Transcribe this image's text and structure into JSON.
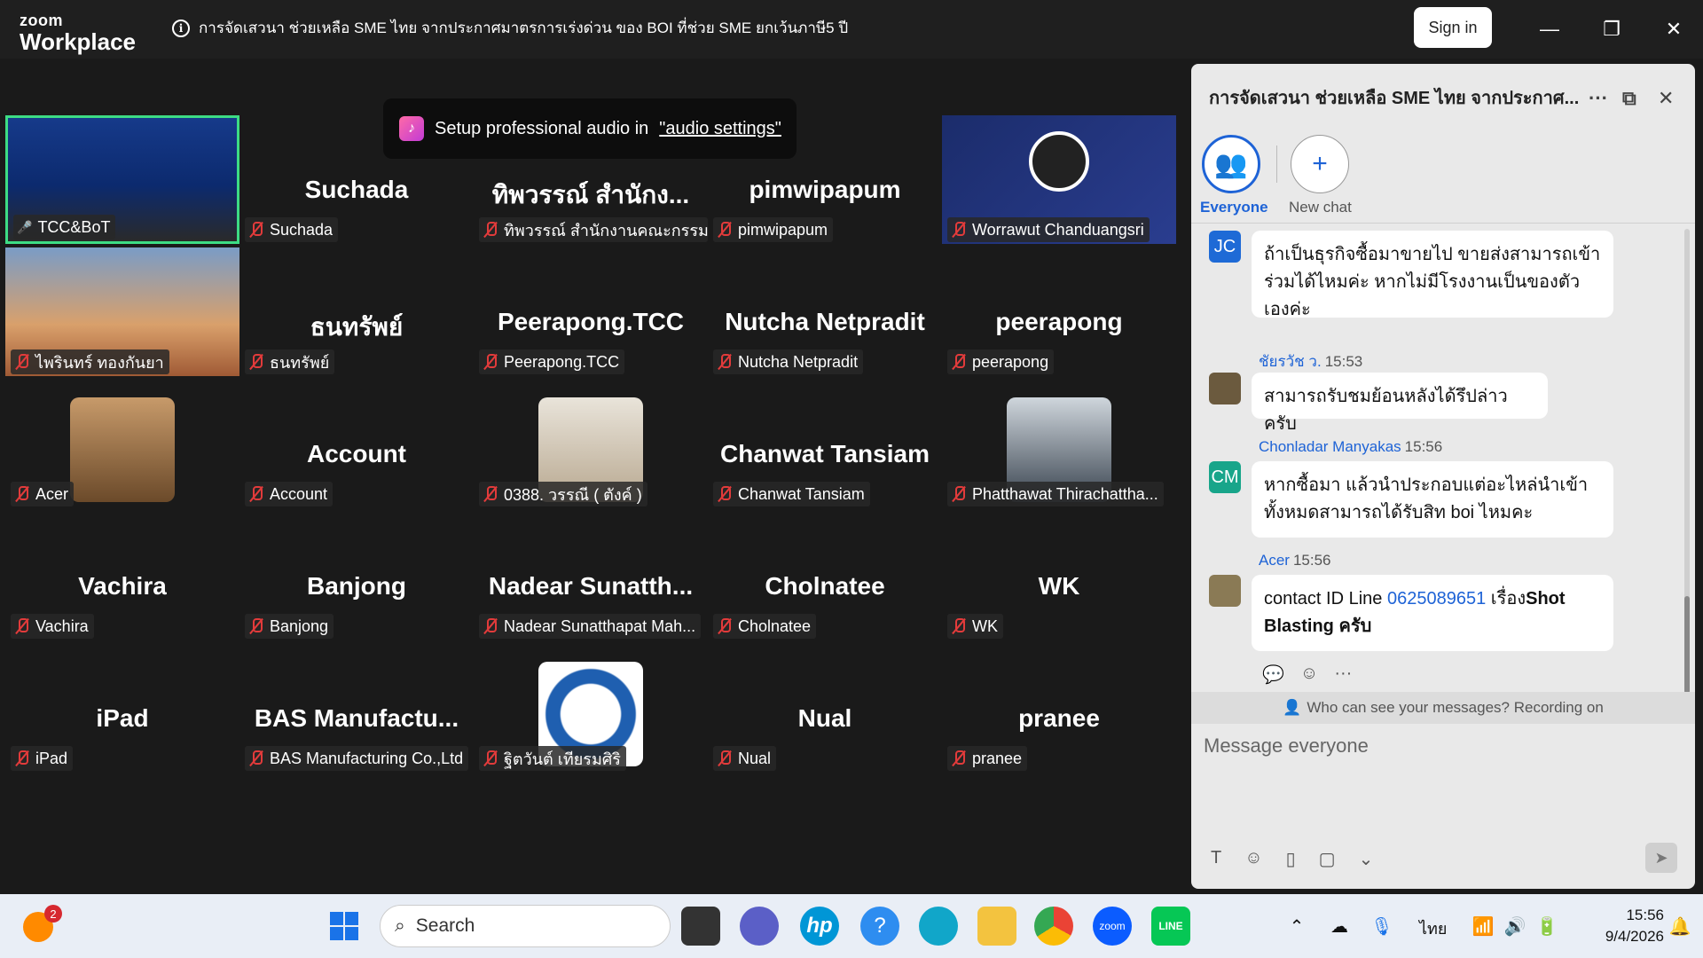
{
  "titlebar": {
    "logo_line1": "zoom",
    "logo_line2": "Workplace",
    "meeting_title": "การจัดเสวนา ช่วยเหลือ SME ไทย จากประกาศมาตรการเร่งด่วน ของ BOI ที่ช่วย SME ยกเว้นภาษี5 ปี",
    "signin_label": "Sign in",
    "minimize": "—",
    "restore": "❐",
    "close": "✕"
  },
  "toast": {
    "text": "Setup professional audio in",
    "link": "\"audio settings\""
  },
  "tiles": [
    {
      "display": "",
      "label": "TCC&BoT",
      "kind": "video-event",
      "muted": false
    },
    {
      "display": "Suchada",
      "label": "Suchada",
      "muted": true
    },
    {
      "display": "ทิพวรรณ์ สำนักง...",
      "label": "ทิพวรรณ์ สำนักงานคณะกรรม...",
      "muted": true
    },
    {
      "display": "pimwipapum",
      "label": "pimwipapum",
      "muted": true
    },
    {
      "display": "",
      "label": "Worrawut Chanduangsri",
      "kind": "video-obs",
      "muted": true
    },
    {
      "display": "",
      "label": "ไพรินทร์ ทองกันยา",
      "kind": "video-raccoon",
      "muted": true
    },
    {
      "display": "ธนทรัพย์",
      "label": "ธนทรัพย์",
      "muted": true
    },
    {
      "display": "Peerapong.TCC",
      "label": "Peerapong.TCC",
      "muted": true
    },
    {
      "display": "Nutcha Netpradit",
      "label": "Nutcha Netpradit",
      "muted": true
    },
    {
      "display": "peerapong",
      "label": "peerapong",
      "muted": true
    },
    {
      "display": "",
      "label": "Acer",
      "kind": "avatar-sunset",
      "muted": true
    },
    {
      "display": "Account",
      "label": "Account",
      "muted": true
    },
    {
      "display": "",
      "label": "0388. วรรณี ( ตังค์ )",
      "kind": "avatar-woman",
      "muted": true
    },
    {
      "display": "Chanwat Tansiam",
      "label": "Chanwat Tansiam",
      "muted": true
    },
    {
      "display": "",
      "label": "Phatthawat Thirachattha...",
      "kind": "avatar-man",
      "muted": true
    },
    {
      "display": "Vachira",
      "label": "Vachira",
      "muted": true
    },
    {
      "display": "Banjong",
      "label": "Banjong",
      "muted": true
    },
    {
      "display": "Nadear  Sunatth...",
      "label": "Nadear Sunatthapat Mah...",
      "muted": true
    },
    {
      "display": "Cholnatee",
      "label": "Cholnatee",
      "muted": true
    },
    {
      "display": "WK",
      "label": "WK",
      "muted": true
    },
    {
      "display": "iPad",
      "label": "iPad",
      "muted": true
    },
    {
      "display": "BAS  Manufactu...",
      "label": "BAS Manufacturing Co.,Ltd",
      "muted": true
    },
    {
      "display": "",
      "label": "ฐิตวันต์ เทียรมศิริ",
      "kind": "avatar-owl",
      "muted": true
    },
    {
      "display": "Nual",
      "label": "Nual",
      "muted": true
    },
    {
      "display": "pranee",
      "label": "pranee",
      "muted": true
    }
  ],
  "chat": {
    "title": "การจัดเสวนา ช่วยเหลือ SME ไทย จากประกาศ...",
    "more_icon": "···",
    "popout_icon": "⧉",
    "close_icon": "✕",
    "tab_everyone": "Everyone",
    "tab_newchat": "New chat",
    "messages": [
      {
        "initials": "JC",
        "avatar_color": "#1e6ad6",
        "sender": "",
        "time": "",
        "text": "ถ้าเป็นธุรกิจซื้อมาขายไป ขายส่งสามารถเข้าร่วมได้ไหมค่ะ หากไม่มีโรงงานเป็นของตัวเองค่ะ"
      },
      {
        "initials": "",
        "avatar_color": "#6b5a3e",
        "sender": "ชัยรวัช ว.",
        "time": "15:53",
        "text": "สามารถรับชมย้อนหลังได้รึปล่าวครับ"
      },
      {
        "initials": "CM",
        "avatar_color": "#18a58a",
        "sender": "Chonladar Manyakas",
        "time": "15:56",
        "text": "หากซื้อมา แล้วนำประกอบแต่อะไหล่นำเข้าทั้งหมดสามารถได้รับสิท boi ไหมคะ"
      },
      {
        "initials": "",
        "avatar_color": "#8a7a55",
        "sender": "Acer",
        "time": "15:56",
        "text_prefix": "contact ID Line ",
        "link": "0625089651",
        "text_suffix": " เรื่อง",
        "bold_text": "Shot Blasting ครับ"
      }
    ],
    "who_can_see": "Who can see your messages? Recording on",
    "compose_placeholder": "Message everyone"
  },
  "taskbar": {
    "search_label": "Search",
    "notification_count": "2",
    "language": "ไทย",
    "time": "15:56",
    "date": "9/4/2026"
  },
  "colors": {
    "active_speaker_border": "#3ddc84",
    "mute_red": "#e23b3b",
    "accent_blue": "#1e63d6"
  }
}
